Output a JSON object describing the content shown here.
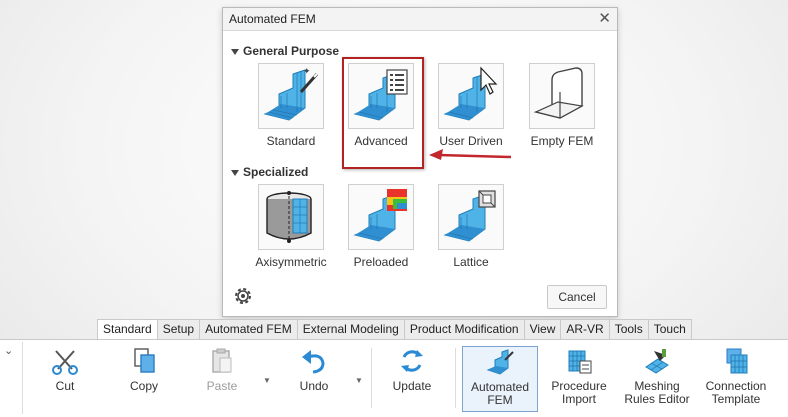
{
  "dialog": {
    "title": "Automated FEM",
    "close_icon": "close-icon",
    "sections": {
      "general": "General Purpose",
      "specialized": "Specialized"
    },
    "general_tiles": [
      {
        "label": "Standard",
        "icon": "magic-wand-mesh-icon"
      },
      {
        "label": "Advanced",
        "icon": "checklist-mesh-icon"
      },
      {
        "label": "User Driven",
        "icon": "cursor-mesh-icon"
      },
      {
        "label": "Empty FEM",
        "icon": "empty-part-icon"
      }
    ],
    "specialized_tiles": [
      {
        "label": "Axisymmetric",
        "icon": "axisymmetric-icon"
      },
      {
        "label": "Preloaded",
        "icon": "preloaded-mesh-icon"
      },
      {
        "label": "Lattice",
        "icon": "lattice-mesh-icon"
      }
    ],
    "highlight_color": "#b22222",
    "cancel_label": "Cancel"
  },
  "ribbon": {
    "tabs": [
      "Standard",
      "Setup",
      "Automated FEM",
      "External Modeling",
      "Product Modification",
      "View",
      "AR-VR",
      "Tools",
      "Touch"
    ],
    "active_tab": "Standard",
    "buttons": {
      "cut": "Cut",
      "copy": "Copy",
      "paste": "Paste",
      "undo": "Undo",
      "update": "Update",
      "automated_fem_1": "Automated",
      "automated_fem_2": "FEM",
      "procedure_import_1": "Procedure",
      "procedure_import_2": "Import",
      "meshing_rules_1": "Meshing",
      "meshing_rules_2": "Rules Editor",
      "connection_template_1": "Connection",
      "connection_template_2": "Template"
    }
  }
}
